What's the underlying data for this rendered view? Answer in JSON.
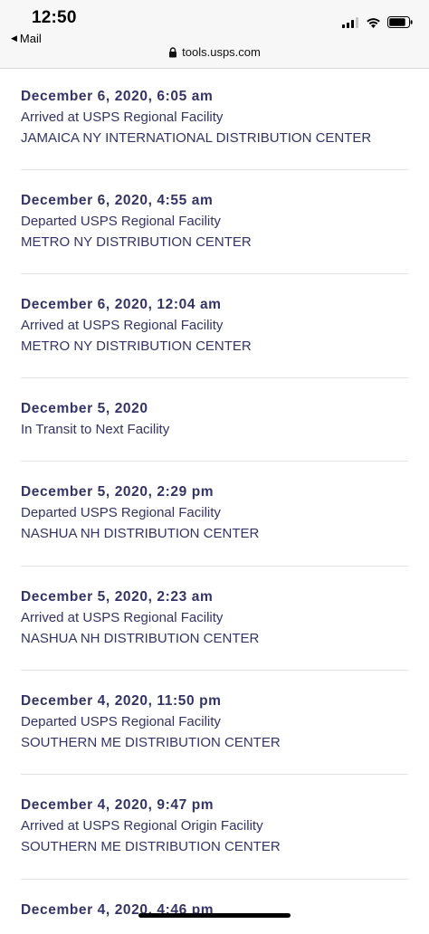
{
  "status_bar": {
    "time": "12:50",
    "back_app": "Mail",
    "url": "tools.usps.com"
  },
  "events": [
    {
      "datetime": "December 6, 2020, 6:05 am",
      "status": "Arrived at USPS Regional Facility",
      "location": "JAMAICA NY INTERNATIONAL DISTRIBUTION CENTER"
    },
    {
      "datetime": "December 6, 2020, 4:55 am",
      "status": "Departed USPS Regional Facility",
      "location": "METRO NY DISTRIBUTION CENTER"
    },
    {
      "datetime": "December 6, 2020, 12:04 am",
      "status": "Arrived at USPS Regional Facility",
      "location": "METRO NY DISTRIBUTION CENTER"
    },
    {
      "datetime": "December 5, 2020",
      "status": "In Transit to Next Facility",
      "location": ""
    },
    {
      "datetime": "December 5, 2020, 2:29 pm",
      "status": "Departed USPS Regional Facility",
      "location": "NASHUA NH DISTRIBUTION CENTER"
    },
    {
      "datetime": "December 5, 2020, 2:23 am",
      "status": "Arrived at USPS Regional Facility",
      "location": "NASHUA NH DISTRIBUTION CENTER"
    },
    {
      "datetime": "December 4, 2020, 11:50 pm",
      "status": "Departed USPS Regional Facility",
      "location": "SOUTHERN ME DISTRIBUTION CENTER"
    },
    {
      "datetime": "December 4, 2020, 9:47 pm",
      "status": "Arrived at USPS Regional Origin Facility",
      "location": "SOUTHERN ME DISTRIBUTION CENTER"
    },
    {
      "datetime": "December 4, 2020, 4:46 pm",
      "status": "",
      "location": ""
    }
  ]
}
